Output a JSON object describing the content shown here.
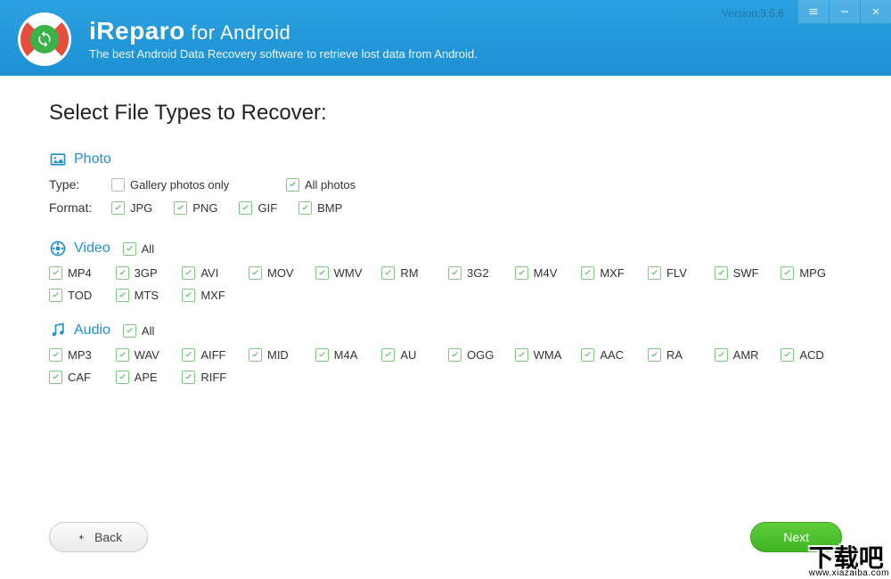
{
  "header": {
    "app_name_bold": "iReparo",
    "app_name_for": " for ",
    "app_name_platform": "Android",
    "subtitle": "The best Android Data Recovery software to retrieve lost data from Android.",
    "version": "Version:3.5.6"
  },
  "page": {
    "title": "Select File Types to Recover:"
  },
  "photo": {
    "heading": "Photo",
    "type_label": "Type:",
    "format_label": "Format:",
    "gallery_only": "Gallery photos only",
    "all_photos": "All photos",
    "formats": [
      "JPG",
      "PNG",
      "GIF",
      "BMP"
    ]
  },
  "video": {
    "heading": "Video",
    "all_label": "All",
    "formats": [
      "MP4",
      "3GP",
      "AVI",
      "MOV",
      "WMV",
      "RM",
      "3G2",
      "M4V",
      "MXF",
      "FLV",
      "SWF",
      "MPG",
      "TOD",
      "MTS",
      "MXF"
    ]
  },
  "audio": {
    "heading": "Audio",
    "all_label": "All",
    "formats": [
      "MP3",
      "WAV",
      "AIFF",
      "MID",
      "M4A",
      "AU",
      "OGG",
      "WMA",
      "AAC",
      "RA",
      "AMR",
      "ACD",
      "CAF",
      "APE",
      "RIFF"
    ]
  },
  "buttons": {
    "back": "Back",
    "next": "Next"
  },
  "watermark": {
    "text": "下载吧",
    "url": "www.xiazaiba.com"
  }
}
